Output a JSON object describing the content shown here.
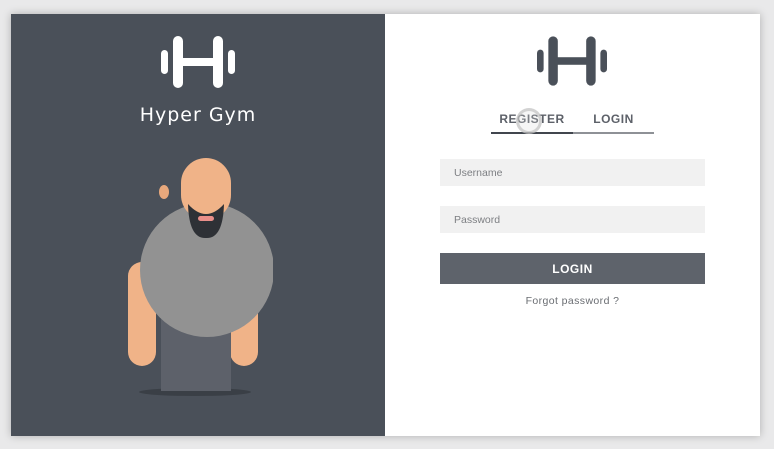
{
  "brand": {
    "name": "Hyper Gym",
    "logo_icon": "dumbbell-icon"
  },
  "auth": {
    "tabs": [
      {
        "label": "REGISTER",
        "active": true
      },
      {
        "label": "LOGIN",
        "active": false
      }
    ],
    "username_placeholder": "Username",
    "password_placeholder": "Password",
    "submit_label": "LOGIN",
    "forgot_label": "Forgot password ?"
  },
  "colors": {
    "left_panel": "#4a5059",
    "button": "#5e636b",
    "field_bg": "#f1f1f1",
    "skin": "#f0b388",
    "shirt": "#929292",
    "pants": "#5d616a"
  }
}
